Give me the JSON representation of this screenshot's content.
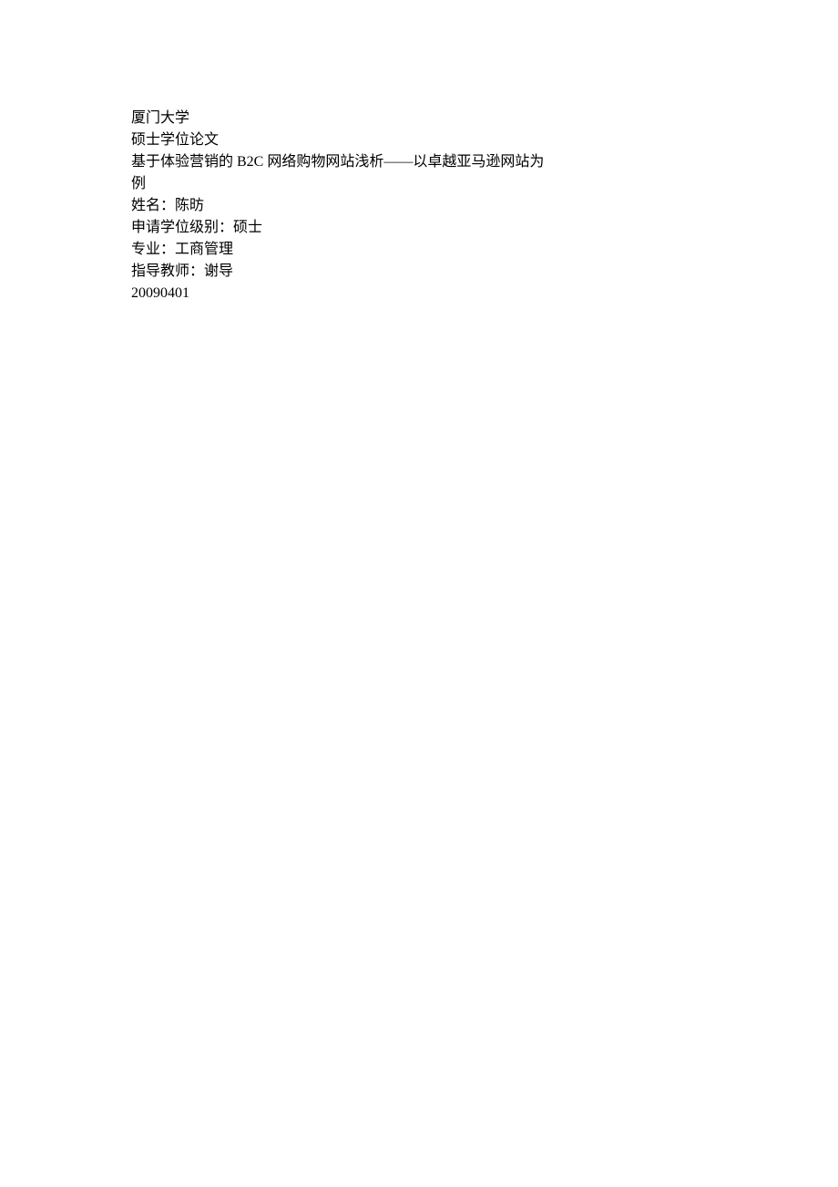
{
  "lines": {
    "university": "厦门大学",
    "degree_type": "硕士学位论文",
    "title_line1": "基于体验营销的 B2C 网络购物网站浅析——以卓越亚马逊网站为",
    "title_line2": "例",
    "name": "姓名：陈昉",
    "degree_level": "申请学位级别：硕士",
    "major": "专业：工商管理",
    "advisor": "指导教师：谢导",
    "date": "20090401"
  }
}
